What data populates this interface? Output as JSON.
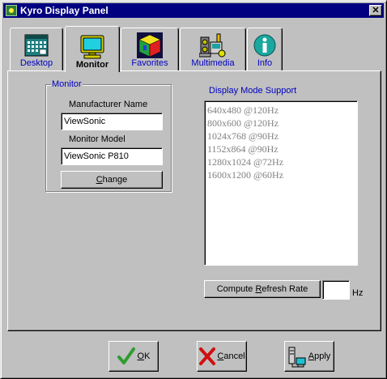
{
  "window": {
    "title": "Kyro Display Panel",
    "close_symbol": "✕"
  },
  "tabs": [
    {
      "label": "Desktop",
      "icon": "desktop-calendar-icon"
    },
    {
      "label": "Monitor",
      "icon": "monitor-icon",
      "active": true
    },
    {
      "label": "Favorites",
      "icon": "favorites-cube-icon"
    },
    {
      "label": "Multimedia",
      "icon": "multimedia-icon"
    },
    {
      "label": "Info",
      "icon": "info-icon"
    }
  ],
  "monitor_group": {
    "title": "Monitor",
    "manufacturer_label": "Manufacturer Name",
    "manufacturer_value": "ViewSonic",
    "model_label": "Monitor Model",
    "model_value": "ViewSonic P810",
    "change_prefix": "",
    "change_accel": "C",
    "change_rest": "hange"
  },
  "display_modes": {
    "title": "Display Mode Support",
    "items": [
      "640x480 @120Hz",
      "800x600 @120Hz",
      "1024x768 @90Hz",
      "1152x864 @90Hz",
      "1280x1024 @72Hz",
      "1600x1200 @60Hz"
    ]
  },
  "refresh": {
    "button_prefix": "Compute ",
    "button_accel": "R",
    "button_rest": "efresh Rate",
    "value": "",
    "unit": "Hz"
  },
  "buttons": {
    "ok_prefix": "",
    "ok_accel": "O",
    "ok_rest": "K",
    "cancel_prefix": "",
    "cancel_accel": "C",
    "cancel_rest": "ancel",
    "apply_prefix": "",
    "apply_accel": "A",
    "apply_rest": "pply"
  },
  "colors": {
    "titlebar": "#000080",
    "face": "#c0c0c0",
    "tab_label": "#0000c0",
    "disabled_text": "#808080",
    "ok_check": "#2e9d2e",
    "cancel_x": "#d01010"
  }
}
